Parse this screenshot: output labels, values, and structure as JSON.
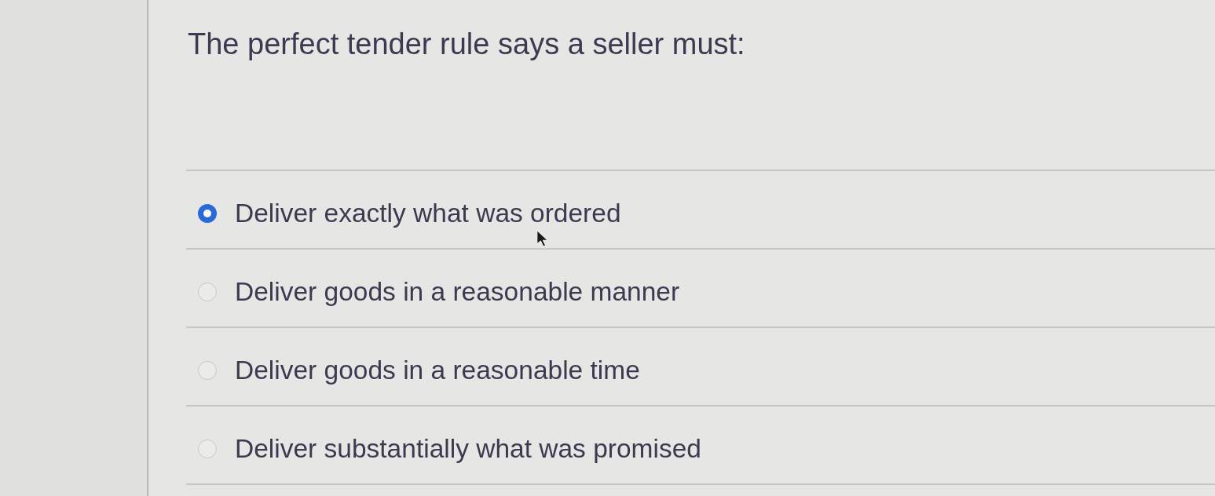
{
  "question": {
    "text": "The perfect tender rule says a seller must:"
  },
  "options": [
    {
      "label": "Deliver exactly what was ordered",
      "selected": true
    },
    {
      "label": "Deliver goods in a reasonable manner",
      "selected": false
    },
    {
      "label": "Deliver goods in a reasonable time",
      "selected": false
    },
    {
      "label": "Deliver substantially what was promised",
      "selected": false
    }
  ]
}
